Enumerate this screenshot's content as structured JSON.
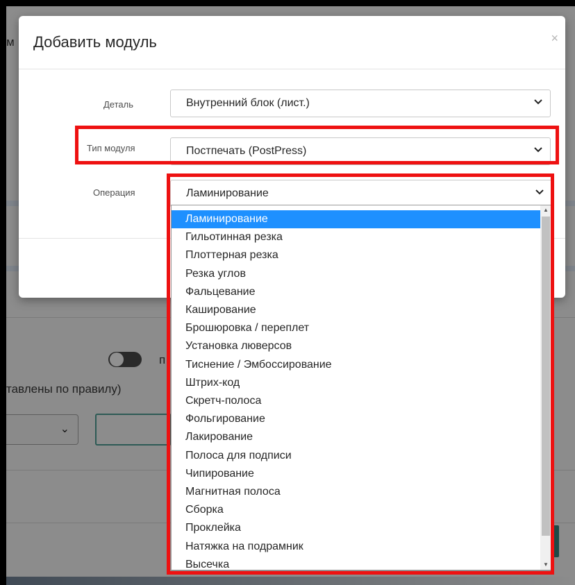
{
  "background": {
    "partial_label": "тавлены по правилу)",
    "left_edge_text_1": "м",
    "left_edge_text_2": "п"
  },
  "modal": {
    "title": "Добавить модуль",
    "close_label": "×",
    "fields": [
      {
        "label": "Деталь",
        "value": "Внутренний блок (лист.)"
      },
      {
        "label": "Тип модуля",
        "value": "Постпечать (PostPress)"
      },
      {
        "label": "Операция",
        "value": "Ламинирование"
      }
    ]
  },
  "dropdown": {
    "options": [
      "Ламинирование",
      "Гильотинная резка",
      "Плоттерная резка",
      "Резка углов",
      "Фальцевание",
      "Каширование",
      "Брошюровка / переплет",
      "Установка люверсов",
      "Тиснение / Эмбоссирование",
      "Штрих-код",
      "Скретч-полоса",
      "Фольгирование",
      "Лакирование",
      "Полоса для подписи",
      "Чипирование",
      "Магнитная полоса",
      "Сборка",
      "Проклейка",
      "Натяжка на подрамник",
      "Высечка"
    ],
    "selected_index": 0
  },
  "colors": {
    "highlight": "#1e90ff",
    "annotation": "#ee1111",
    "overlay": "#8c8c8c"
  }
}
